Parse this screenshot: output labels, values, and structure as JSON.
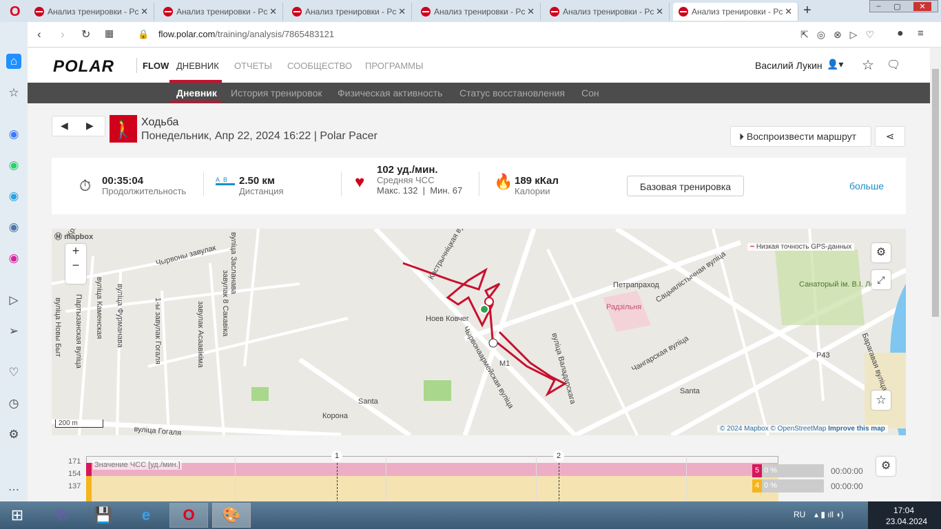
{
  "browser": {
    "tabs": [
      "Анализ тренировки - Pc",
      "Анализ тренировки - Pc",
      "Анализ тренировки - Pc",
      "Анализ тренировки - Pc",
      "Анализ тренировки - Pc",
      "Анализ тренировки - Pc"
    ],
    "url_domain": "flow.polar.com",
    "url_path": "/training/analysis/7865483121"
  },
  "header": {
    "logo": "POLAR",
    "flow": "FLOW",
    "nav": [
      "ДНЕВНИК",
      "ОТЧЕТЫ",
      "СООБЩЕСТВО",
      "ПРОГРАММЫ"
    ],
    "user": "Василий Лукин"
  },
  "subnav": [
    "Дневник",
    "История тренировок",
    "Физическая активность",
    "Статус восстановления",
    "Сон"
  ],
  "activity": {
    "sport": "Ходьба",
    "datetime": "Понедельник, Апр 22, 2024 16:22 | Polar Pacer",
    "replay": "Воспроизвести маршрут"
  },
  "stats": {
    "duration": "00:35:04",
    "duration_label": "Продолжительность",
    "distance": "2.50 км",
    "distance_label": "Дистанция",
    "hr": "102 уд./мин.",
    "hr_label": "Средняя ЧСС",
    "hr_max_min": "Макс. 132  |  Мин. 67",
    "calories": "189 кКал",
    "calories_label": "Калории",
    "base_button": "Базовая тренировка",
    "more": "больше"
  },
  "map": {
    "attribution_logo": "mapbox",
    "gps_legend": "Низкая точность GPS-данных",
    "scale": "200 m",
    "copyright": "© 2024 Mapbox",
    "osm": "© OpenStreetMap",
    "improve": "Improve this map",
    "labels": [
      "Крылова",
      "Чырвоны завулак",
      "вуліца Засланава",
      "вуліца Каменская",
      "вуліца Фурманава",
      "Партызанская вуліца",
      "вуліца Новы Быт",
      "1-ы завулак Гогаля",
      "завулак 8 Сакавіка",
      "завулак Асаавікіма",
      "вуліца Гогаля",
      "Santa",
      "Корона",
      "Ноев Ковчег",
      "Кастрычніцкая вуліца",
      "Чырвонаармейская вуліца",
      "вуліца Валадарскага",
      "Петрапраход",
      "Радзільня",
      "Сацыялістычная вуліца",
      "Чангарская вуліца",
      "Santa",
      "Санаторый ім. В.І. Леніна",
      "Барагавая вуліца",
      "Р43",
      "М1"
    ]
  },
  "chart": {
    "markers": [
      "1",
      "2"
    ],
    "yticks": [
      "171",
      "154",
      "137"
    ],
    "series_label": "Значение ЧСС [уд./мин.]",
    "zones": [
      {
        "zone": "5",
        "pct": "0 %",
        "time": "00:00:00",
        "color": "#d6175a"
      },
      {
        "zone": "4",
        "pct": "0 %",
        "time": "00:00:00",
        "color": "#f5b51d"
      }
    ]
  },
  "taskbar": {
    "lang": "RU",
    "time": "17:04",
    "date": "23.04.2024"
  }
}
